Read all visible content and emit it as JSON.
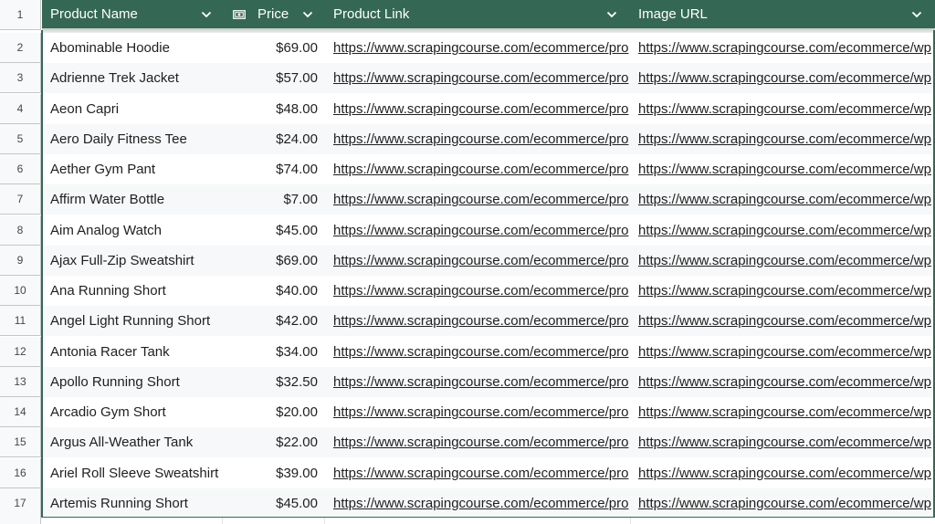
{
  "header": {
    "row_number": "1",
    "columns": [
      {
        "label": "Product Name",
        "icon": "chevron-down-icon"
      },
      {
        "label": "Price",
        "icon": "chevron-down-icon",
        "type_icon": "money-icon"
      },
      {
        "label": "Product Link",
        "icon": "chevron-down-icon"
      },
      {
        "label": "Image URL",
        "icon": "chevron-down-icon"
      }
    ]
  },
  "colors": {
    "header_bg": "#356854",
    "header_text": "#ffffff",
    "alt_row_bg": "#f6f8f9"
  },
  "rows": [
    {
      "num": "2",
      "name": "Abominable Hoodie",
      "price": "$69.00",
      "link": "https://www.scrapingcourse.com/ecommerce/pro",
      "image": "https://www.scrapingcourse.com/ecommerce/wp"
    },
    {
      "num": "3",
      "name": "Adrienne Trek Jacket",
      "price": "$57.00",
      "link": "https://www.scrapingcourse.com/ecommerce/pro",
      "image": "https://www.scrapingcourse.com/ecommerce/wp"
    },
    {
      "num": "4",
      "name": "Aeon Capri",
      "price": "$48.00",
      "link": "https://www.scrapingcourse.com/ecommerce/pro",
      "image": "https://www.scrapingcourse.com/ecommerce/wp"
    },
    {
      "num": "5",
      "name": "Aero Daily Fitness Tee",
      "price": "$24.00",
      "link": "https://www.scrapingcourse.com/ecommerce/pro",
      "image": "https://www.scrapingcourse.com/ecommerce/wp"
    },
    {
      "num": "6",
      "name": "Aether Gym Pant",
      "price": "$74.00",
      "link": "https://www.scrapingcourse.com/ecommerce/pro",
      "image": "https://www.scrapingcourse.com/ecommerce/wp"
    },
    {
      "num": "7",
      "name": "Affirm Water Bottle",
      "price": "$7.00",
      "link": "https://www.scrapingcourse.com/ecommerce/pro",
      "image": "https://www.scrapingcourse.com/ecommerce/wp"
    },
    {
      "num": "8",
      "name": "Aim Analog Watch",
      "price": "$45.00",
      "link": "https://www.scrapingcourse.com/ecommerce/pro",
      "image": "https://www.scrapingcourse.com/ecommerce/wp"
    },
    {
      "num": "9",
      "name": "Ajax Full-Zip Sweatshirt",
      "price": "$69.00",
      "link": "https://www.scrapingcourse.com/ecommerce/pro",
      "image": "https://www.scrapingcourse.com/ecommerce/wp"
    },
    {
      "num": "10",
      "name": "Ana Running Short",
      "price": "$40.00",
      "link": "https://www.scrapingcourse.com/ecommerce/pro",
      "image": "https://www.scrapingcourse.com/ecommerce/wp"
    },
    {
      "num": "11",
      "name": "Angel Light Running Short",
      "price": "$42.00",
      "link": "https://www.scrapingcourse.com/ecommerce/pro",
      "image": "https://www.scrapingcourse.com/ecommerce/wp"
    },
    {
      "num": "12",
      "name": "Antonia Racer Tank",
      "price": "$34.00",
      "link": "https://www.scrapingcourse.com/ecommerce/pro",
      "image": "https://www.scrapingcourse.com/ecommerce/wp"
    },
    {
      "num": "13",
      "name": "Apollo Running Short",
      "price": "$32.50",
      "link": "https://www.scrapingcourse.com/ecommerce/pro",
      "image": "https://www.scrapingcourse.com/ecommerce/wp"
    },
    {
      "num": "14",
      "name": "Arcadio Gym Short",
      "price": "$20.00",
      "link": "https://www.scrapingcourse.com/ecommerce/pro",
      "image": "https://www.scrapingcourse.com/ecommerce/wp"
    },
    {
      "num": "15",
      "name": "Argus All-Weather Tank",
      "price": "$22.00",
      "link": "https://www.scrapingcourse.com/ecommerce/pro",
      "image": "https://www.scrapingcourse.com/ecommerce/wp"
    },
    {
      "num": "16",
      "name": "Ariel Roll Sleeve Sweatshirt",
      "price": "$39.00",
      "link": "https://www.scrapingcourse.com/ecommerce/pro",
      "image": "https://www.scrapingcourse.com/ecommerce/wp"
    },
    {
      "num": "17",
      "name": "Artemis Running Short",
      "price": "$45.00",
      "link": "https://www.scrapingcourse.com/ecommerce/pro",
      "image": "https://www.scrapingcourse.com/ecommerce/wp"
    }
  ]
}
